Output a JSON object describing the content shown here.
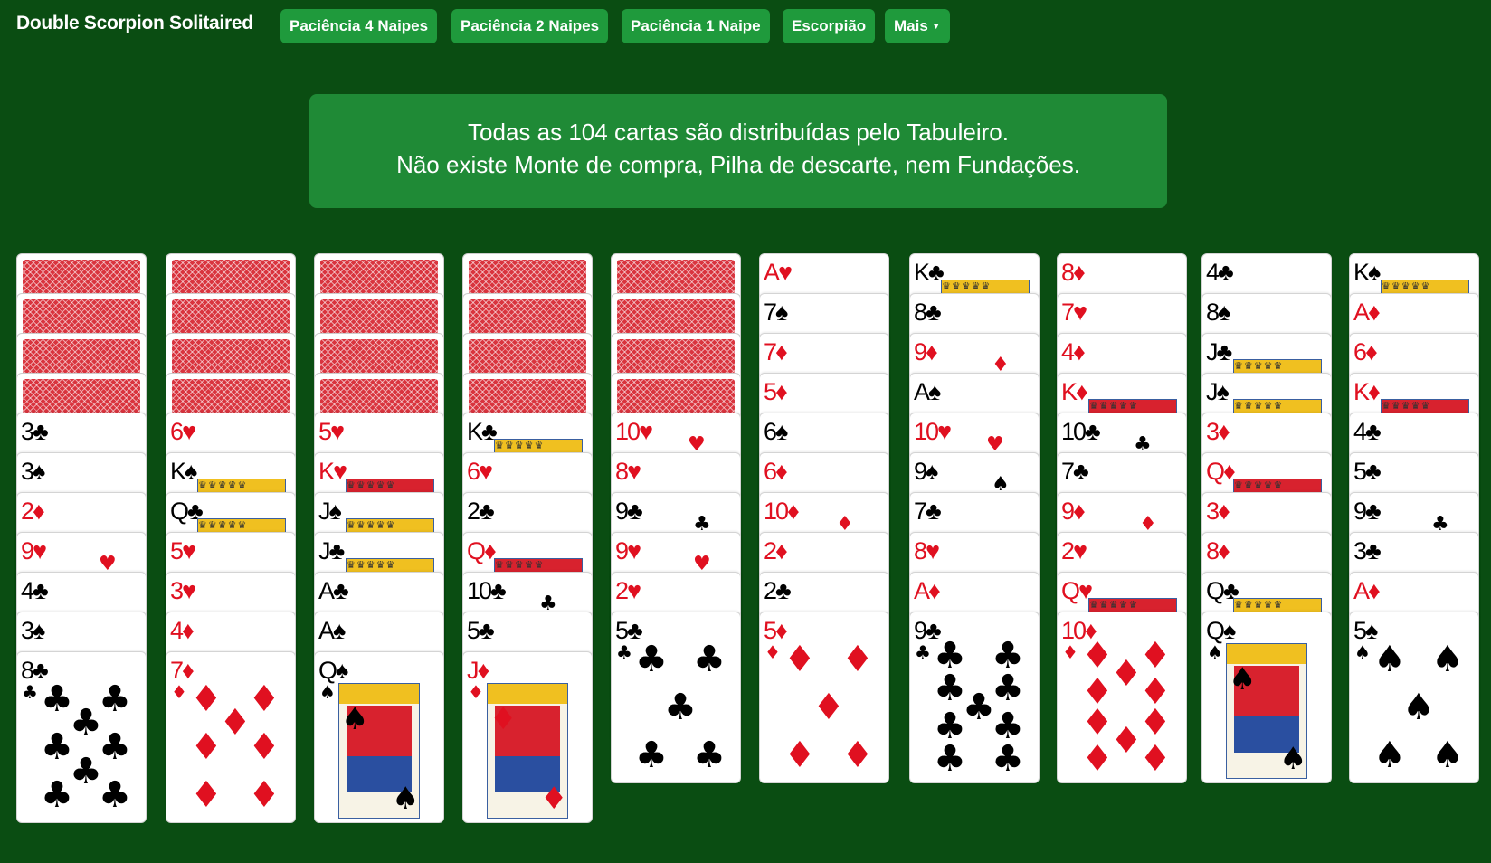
{
  "app": {
    "title": "Double Scorpion Solitaired"
  },
  "nav": [
    {
      "label": "Paciência 4 Naipes"
    },
    {
      "label": "Paciência 2 Naipes"
    },
    {
      "label": "Paciência 1 Naipe"
    },
    {
      "label": "Escorpião"
    },
    {
      "label": "Mais",
      "has_dropdown": true
    }
  ],
  "info": {
    "line1": "Todas as 104 cartas são distribuídas pelo Tabuleiro.",
    "line2": "Não existe Monte de compra, Pilha de descarte, nem Fundações."
  },
  "colors": {
    "background": "#0a4d12",
    "button": "#1f9a3c",
    "info_box": "#1f8a36",
    "card_back": "#d9343e",
    "red_suit": "#e01020",
    "black_suit": "#000000"
  },
  "tableau": [
    {
      "face_down": 4,
      "cards": [
        {
          "rank": "3",
          "suit": "♣"
        },
        {
          "rank": "3",
          "suit": "♠"
        },
        {
          "rank": "2",
          "suit": "♦"
        },
        {
          "rank": "9",
          "suit": "♥"
        },
        {
          "rank": "4",
          "suit": "♣"
        },
        {
          "rank": "3",
          "suit": "♠"
        },
        {
          "rank": "8",
          "suit": "♣"
        }
      ]
    },
    {
      "face_down": 4,
      "cards": [
        {
          "rank": "6",
          "suit": "♥"
        },
        {
          "rank": "K",
          "suit": "♠"
        },
        {
          "rank": "Q",
          "suit": "♣"
        },
        {
          "rank": "5",
          "suit": "♥"
        },
        {
          "rank": "3",
          "suit": "♥"
        },
        {
          "rank": "4",
          "suit": "♦"
        },
        {
          "rank": "7",
          "suit": "♦"
        }
      ]
    },
    {
      "face_down": 4,
      "cards": [
        {
          "rank": "5",
          "suit": "♥"
        },
        {
          "rank": "K",
          "suit": "♥"
        },
        {
          "rank": "J",
          "suit": "♠"
        },
        {
          "rank": "J",
          "suit": "♣"
        },
        {
          "rank": "A",
          "suit": "♣"
        },
        {
          "rank": "A",
          "suit": "♠"
        },
        {
          "rank": "Q",
          "suit": "♠"
        }
      ]
    },
    {
      "face_down": 4,
      "cards": [
        {
          "rank": "K",
          "suit": "♣"
        },
        {
          "rank": "6",
          "suit": "♥"
        },
        {
          "rank": "2",
          "suit": "♣"
        },
        {
          "rank": "Q",
          "suit": "♦"
        },
        {
          "rank": "10",
          "suit": "♣"
        },
        {
          "rank": "5",
          "suit": "♣"
        },
        {
          "rank": "J",
          "suit": "♦"
        }
      ]
    },
    {
      "face_down": 4,
      "cards": [
        {
          "rank": "10",
          "suit": "♥"
        },
        {
          "rank": "8",
          "suit": "♥"
        },
        {
          "rank": "9",
          "suit": "♣"
        },
        {
          "rank": "9",
          "suit": "♥"
        },
        {
          "rank": "2",
          "suit": "♥"
        },
        {
          "rank": "5",
          "suit": "♣"
        }
      ]
    },
    {
      "face_down": 0,
      "cards": [
        {
          "rank": "A",
          "suit": "♥"
        },
        {
          "rank": "7",
          "suit": "♠"
        },
        {
          "rank": "7",
          "suit": "♦"
        },
        {
          "rank": "5",
          "suit": "♦"
        },
        {
          "rank": "6",
          "suit": "♠"
        },
        {
          "rank": "6",
          "suit": "♦"
        },
        {
          "rank": "10",
          "suit": "♦"
        },
        {
          "rank": "2",
          "suit": "♦"
        },
        {
          "rank": "2",
          "suit": "♣"
        },
        {
          "rank": "5",
          "suit": "♦"
        }
      ]
    },
    {
      "face_down": 0,
      "cards": [
        {
          "rank": "K",
          "suit": "♣"
        },
        {
          "rank": "8",
          "suit": "♣"
        },
        {
          "rank": "9",
          "suit": "♦"
        },
        {
          "rank": "A",
          "suit": "♠"
        },
        {
          "rank": "10",
          "suit": "♥"
        },
        {
          "rank": "9",
          "suit": "♠"
        },
        {
          "rank": "7",
          "suit": "♣"
        },
        {
          "rank": "8",
          "suit": "♥"
        },
        {
          "rank": "A",
          "suit": "♦"
        },
        {
          "rank": "9",
          "suit": "♣"
        }
      ]
    },
    {
      "face_down": 0,
      "cards": [
        {
          "rank": "8",
          "suit": "♦"
        },
        {
          "rank": "7",
          "suit": "♥"
        },
        {
          "rank": "4",
          "suit": "♦"
        },
        {
          "rank": "K",
          "suit": "♦"
        },
        {
          "rank": "10",
          "suit": "♣"
        },
        {
          "rank": "7",
          "suit": "♣"
        },
        {
          "rank": "9",
          "suit": "♦"
        },
        {
          "rank": "2",
          "suit": "♥"
        },
        {
          "rank": "Q",
          "suit": "♥"
        },
        {
          "rank": "10",
          "suit": "♦"
        }
      ]
    },
    {
      "face_down": 0,
      "cards": [
        {
          "rank": "4",
          "suit": "♣"
        },
        {
          "rank": "8",
          "suit": "♠"
        },
        {
          "rank": "J",
          "suit": "♣"
        },
        {
          "rank": "J",
          "suit": "♠"
        },
        {
          "rank": "3",
          "suit": "♦"
        },
        {
          "rank": "Q",
          "suit": "♦"
        },
        {
          "rank": "3",
          "suit": "♦"
        },
        {
          "rank": "8",
          "suit": "♦"
        },
        {
          "rank": "Q",
          "suit": "♣"
        },
        {
          "rank": "Q",
          "suit": "♠"
        }
      ]
    },
    {
      "face_down": 0,
      "cards": [
        {
          "rank": "K",
          "suit": "♠"
        },
        {
          "rank": "A",
          "suit": "♦"
        },
        {
          "rank": "6",
          "suit": "♦"
        },
        {
          "rank": "K",
          "suit": "♦"
        },
        {
          "rank": "4",
          "suit": "♣"
        },
        {
          "rank": "5",
          "suit": "♣"
        },
        {
          "rank": "9",
          "suit": "♣"
        },
        {
          "rank": "3",
          "suit": "♣"
        },
        {
          "rank": "A",
          "suit": "♦"
        },
        {
          "rank": "5",
          "suit": "♠"
        }
      ]
    }
  ]
}
